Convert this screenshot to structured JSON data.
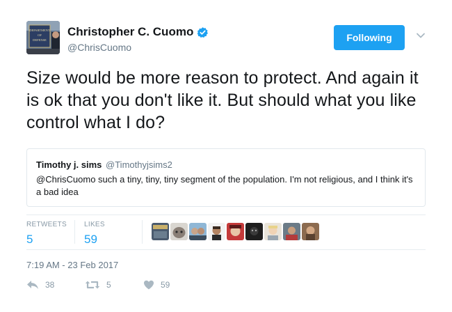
{
  "author": {
    "display_name": "Christopher C. Cuomo",
    "handle": "@ChrisCuomo",
    "verified": true,
    "avatar_sign_text": "DEPARTMENT OF DEFENSE"
  },
  "follow_button": {
    "label": "Following"
  },
  "tweet": {
    "text": "Size would be more reason to protect. And again it is ok that you don't like it. But should what you like control what I do?"
  },
  "quoted_tweet": {
    "name": "Timothy j. sims",
    "handle": "@Timothyjsims2",
    "text": "@ChrisCuomo such a tiny, tiny, tiny segment of the population. I'm not religious, and I think it's a bad idea"
  },
  "stats": {
    "retweets_label": "RETWEETS",
    "retweets_value": "5",
    "likes_label": "LIKES",
    "likes_value": "59"
  },
  "timestamp": "7:19 AM - 23 Feb 2017",
  "actions": {
    "reply_count": "38",
    "retweet_count": "5",
    "like_count": "59"
  },
  "colors": {
    "accent": "#1da1f2",
    "muted": "#657786",
    "border": "#e1e8ed"
  },
  "icons": [
    "verified-badge-icon",
    "chevron-down-icon",
    "reply-icon",
    "retweet-icon",
    "heart-icon"
  ]
}
